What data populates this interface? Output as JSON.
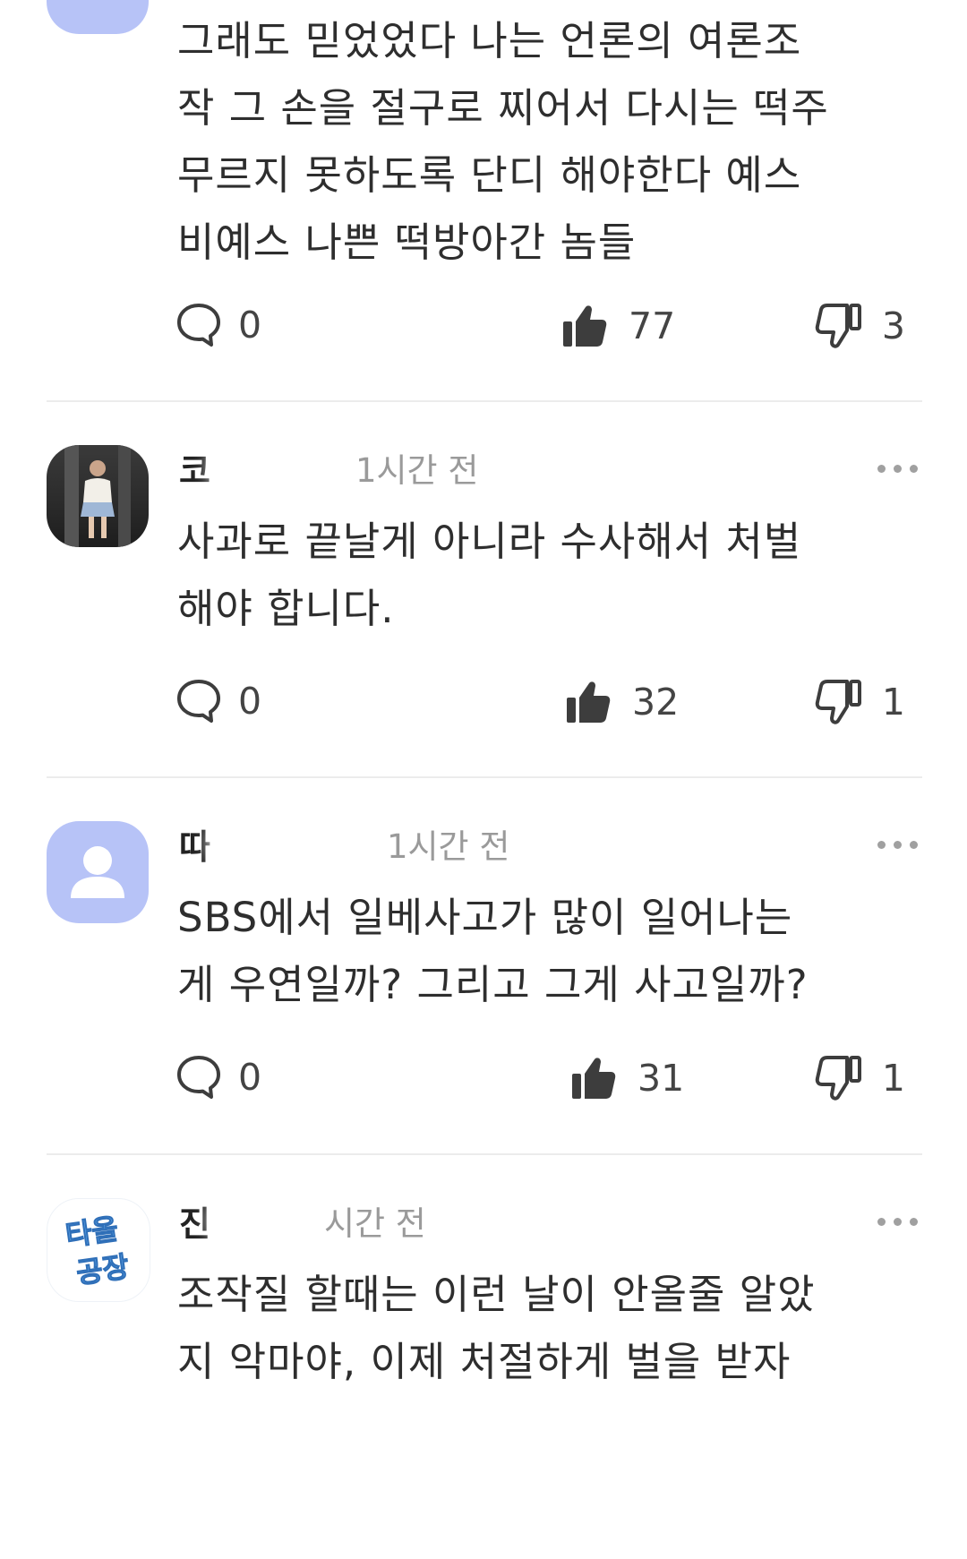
{
  "comments": [
    {
      "author": "",
      "time": "",
      "text": "그래도 믿었었다 나는 언론의 여론조\n작 그 손을 절구로 찌어서 다시는 떡주\n무르지 못하도록 단디 해야한다 예스\n비예스 나쁜 떡방아간 놈들",
      "replies": "0",
      "likes": "77",
      "dislikes": "3",
      "avatar": "default-avatar"
    },
    {
      "author": "코",
      "time": "1시간 전",
      "text": "사과로 끝날게 아니라 수사해서 처벌\n해야 합니다.",
      "replies": "0",
      "likes": "32",
      "dislikes": "1",
      "avatar": "photo-avatar"
    },
    {
      "author": "따",
      "time": "1시간 전",
      "text": "SBS에서 일베사고가 많이 일어나는\n게 우연일까? 그리고 그게 사고일까?",
      "replies": "0",
      "likes": "31",
      "dislikes": "1",
      "avatar": "default-avatar"
    },
    {
      "author": "진",
      "time": "시간 전",
      "text": "조작질 할때는 이런 날이 안올줄 알았\n지 악마야, 이제 처절하게 벌을 받자",
      "replies": "",
      "likes": "",
      "dislikes": "",
      "avatar": "logo-avatar",
      "avatar_text": [
        "타올",
        "공장"
      ]
    }
  ],
  "colors": {
    "default_avatar_bg": "#b7c3f7",
    "default_avatar_fg": "#ffffff",
    "icon": "#3d3d3d",
    "time": "#9a9a9a",
    "divider": "#ececec",
    "logo_text": "#5aa3e8"
  }
}
